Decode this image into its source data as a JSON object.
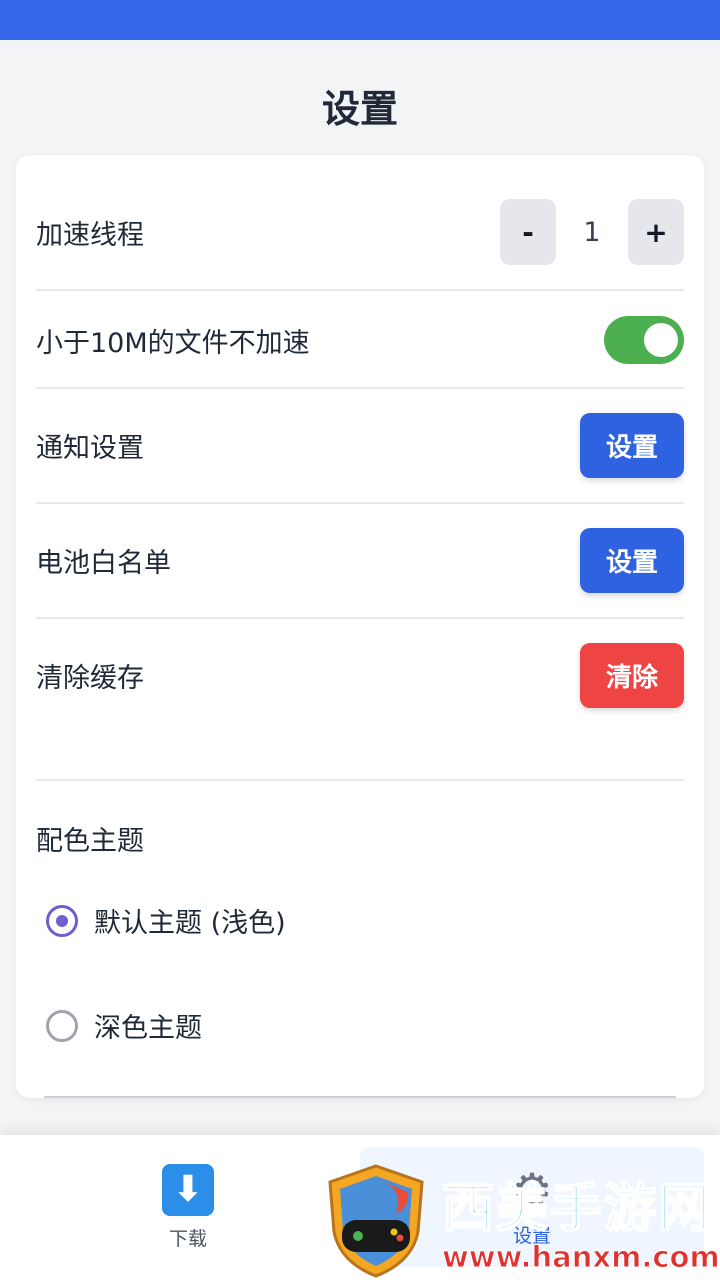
{
  "header": {
    "title": "设置"
  },
  "settings": {
    "threads": {
      "label": "加速线程",
      "minus": "-",
      "value": "1",
      "plus": "+"
    },
    "small_file": {
      "label": "小于10M的文件不加速",
      "enabled": true
    },
    "notification": {
      "label": "通知设置",
      "button": "设置"
    },
    "battery": {
      "label": "电池白名单",
      "button": "设置"
    },
    "cache": {
      "label": "清除缓存",
      "button": "清除"
    }
  },
  "theme": {
    "title": "配色主题",
    "options": [
      {
        "label": "默认主题 (浅色)",
        "selected": true
      },
      {
        "label": "深色主题",
        "selected": false
      }
    ]
  },
  "nav": {
    "items": [
      {
        "label": "下载",
        "icon": "download-icon"
      },
      {
        "label": "设置",
        "icon": "gear-icon",
        "active": true
      }
    ]
  },
  "watermark": {
    "name": "西美手游网",
    "url": "www.hanxm.com"
  },
  "colors": {
    "primary": "#2e62e0",
    "danger": "#ef4444",
    "toggle_on": "#4caf50",
    "radio_accent": "#6b5fd3",
    "status_bar": "#3366e8"
  }
}
